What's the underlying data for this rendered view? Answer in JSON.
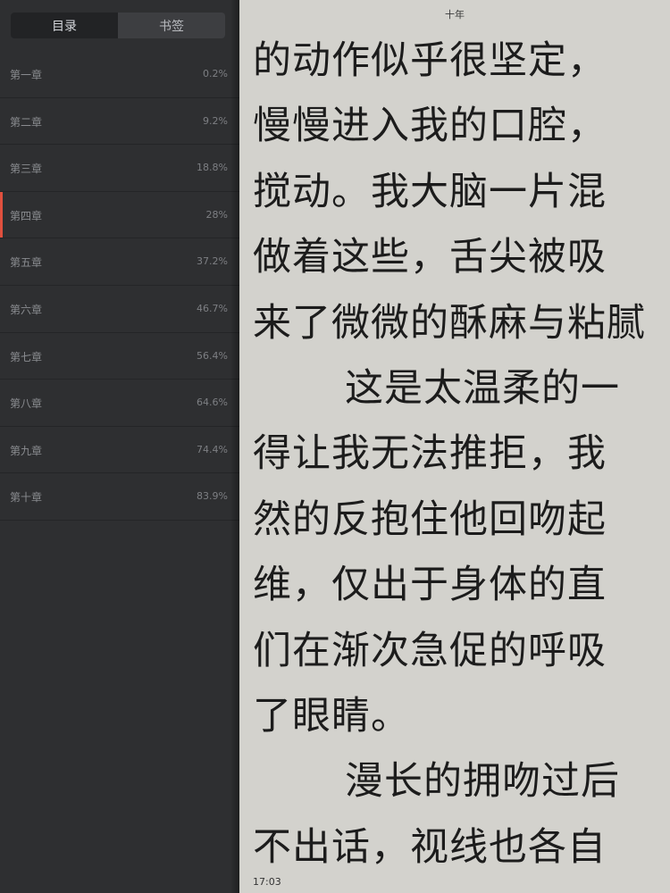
{
  "sidebar": {
    "tabs": [
      {
        "label": "目录",
        "active": true
      },
      {
        "label": "书签",
        "active": false
      }
    ],
    "chapters": [
      {
        "title": "第一章",
        "progress": "0.2%"
      },
      {
        "title": "第二章",
        "progress": "9.2%"
      },
      {
        "title": "第三章",
        "progress": "18.8%"
      },
      {
        "title": "第四章",
        "progress": "28%",
        "current": true
      },
      {
        "title": "第五章",
        "progress": "37.2%"
      },
      {
        "title": "第六章",
        "progress": "46.7%"
      },
      {
        "title": "第七章",
        "progress": "56.4%"
      },
      {
        "title": "第八章",
        "progress": "64.6%"
      },
      {
        "title": "第九章",
        "progress": "74.4%"
      },
      {
        "title": "第十章",
        "progress": "83.9%"
      }
    ],
    "current_marker_color": "#e0503e"
  },
  "reader": {
    "book_title": "十年",
    "lines": [
      {
        "text": "的动作似乎很坚定，"
      },
      {
        "text": "慢慢进入我的口腔，"
      },
      {
        "text": "搅动。我大脑一片混"
      },
      {
        "text": "做着这些，舌尖被吸"
      },
      {
        "text": "来了微微的酥麻与粘腻"
      },
      {
        "text": "这是太温柔的一",
        "indent": true
      },
      {
        "text": "得让我无法推拒，我"
      },
      {
        "text": "然的反抱住他回吻起"
      },
      {
        "text": "维，仅出于身体的直"
      },
      {
        "text": "们在渐次急促的呼吸"
      },
      {
        "text": "了眼睛。"
      },
      {
        "text": "漫长的拥吻过后",
        "indent": true
      },
      {
        "text": "不出话，视线也各自"
      }
    ],
    "clock": "17:03"
  }
}
